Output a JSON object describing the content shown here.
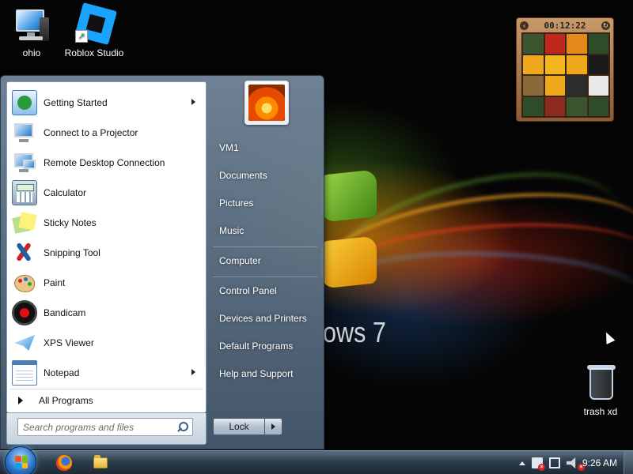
{
  "desktop": {
    "icons": [
      {
        "label": "ohio",
        "icon": "computer-icon"
      },
      {
        "label": "Roblox Studio",
        "icon": "roblox-studio-icon"
      },
      {
        "label": "trash xd",
        "icon": "recycle-bin-icon"
      }
    ],
    "wallpaper_text": "ows 7"
  },
  "gadget": {
    "name": "slide-puzzle",
    "timer": "00:12:22",
    "tiles": [
      "#3b5530",
      "#c0281e",
      "#e48a1a",
      "#2f4c2a",
      "#f0a91c",
      "#f5b51e",
      "#f0a91c",
      "#1a1a1a",
      "#8a6a3a",
      "#f0a91c",
      "#2c2c2c",
      "#e8e8e8",
      "#2f4c2a",
      "#8c2a20",
      "#3b5530",
      "#2f4c2a"
    ]
  },
  "start_menu": {
    "programs": [
      {
        "label": "Getting Started",
        "icon": "getting-started-icon",
        "has_submenu": true
      },
      {
        "label": "Connect to a Projector",
        "icon": "projector-icon",
        "has_submenu": false
      },
      {
        "label": "Remote Desktop Connection",
        "icon": "remote-desktop-icon",
        "has_submenu": false
      },
      {
        "label": "Calculator",
        "icon": "calculator-icon",
        "has_submenu": false
      },
      {
        "label": "Sticky Notes",
        "icon": "sticky-notes-icon",
        "has_submenu": false
      },
      {
        "label": "Snipping Tool",
        "icon": "snipping-tool-icon",
        "has_submenu": false
      },
      {
        "label": "Paint",
        "icon": "paint-icon",
        "has_submenu": false
      },
      {
        "label": "Bandicam",
        "icon": "bandicam-icon",
        "has_submenu": false
      },
      {
        "label": "XPS Viewer",
        "icon": "xps-viewer-icon",
        "has_submenu": false
      },
      {
        "label": "Notepad",
        "icon": "notepad-icon",
        "has_submenu": true
      }
    ],
    "all_programs_label": "All Programs",
    "search_placeholder": "Search programs and files",
    "user_name": "VM1",
    "places": [
      {
        "label": "VM1"
      },
      {
        "label": "Documents"
      },
      {
        "label": "Pictures"
      },
      {
        "label": "Music"
      },
      {
        "label": "Computer"
      },
      {
        "label": "Control Panel"
      },
      {
        "label": "Devices and Printers"
      },
      {
        "label": "Default Programs"
      },
      {
        "label": "Help and Support"
      }
    ],
    "lock_label": "Lock"
  },
  "taskbar": {
    "pinned": [
      {
        "icon": "firefox-icon"
      },
      {
        "icon": "windows-explorer-icon"
      }
    ],
    "tray_icons": [
      "show-hidden-icons-chevron",
      "action-center-flag-icon",
      "network-icon",
      "volume-icon"
    ],
    "clock": "9:26 AM"
  },
  "colors": {
    "taskbar": "#2e3d4c",
    "start_menu_border": "#7f9db9",
    "accent_blue": "#2a73c8"
  }
}
